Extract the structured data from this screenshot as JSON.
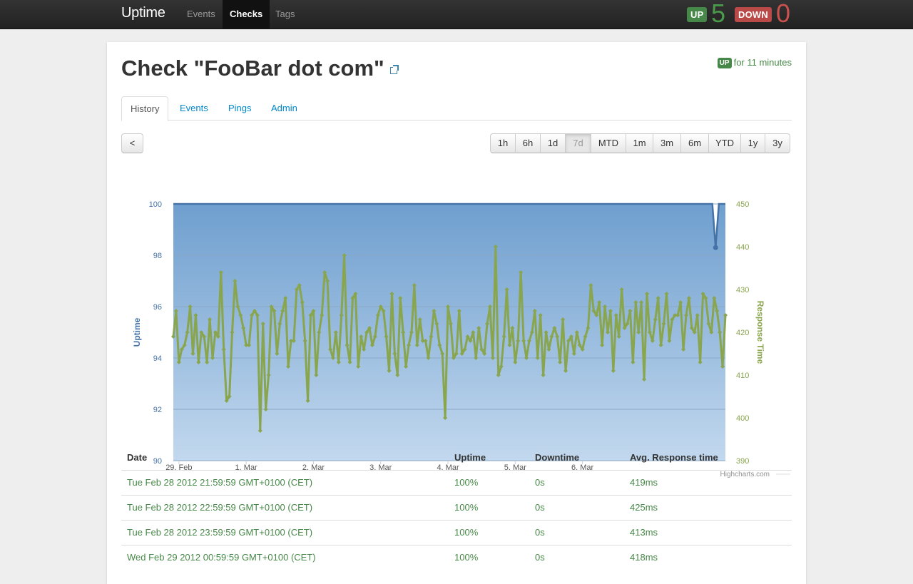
{
  "navbar": {
    "brand": "Uptime",
    "items": [
      {
        "label": "Events",
        "active": false
      },
      {
        "label": "Checks",
        "active": true
      },
      {
        "label": "Tags",
        "active": false
      }
    ],
    "up_label": "UP",
    "up_count": "5",
    "down_label": "DOWN",
    "down_count": "0"
  },
  "check": {
    "title": "Check \"FooBar dot com\"",
    "status_badge": "UP",
    "status_text": "for 11 minutes"
  },
  "tabs": [
    {
      "label": "History",
      "active": true
    },
    {
      "label": "Events",
      "active": false
    },
    {
      "label": "Pings",
      "active": false
    },
    {
      "label": "Admin",
      "active": false
    }
  ],
  "back_button": "<",
  "ranges": [
    {
      "label": "1h",
      "active": false
    },
    {
      "label": "6h",
      "active": false
    },
    {
      "label": "1d",
      "active": false
    },
    {
      "label": "7d",
      "active": true
    },
    {
      "label": "MTD",
      "active": false
    },
    {
      "label": "1m",
      "active": false
    },
    {
      "label": "3m",
      "active": false
    },
    {
      "label": "6m",
      "active": false
    },
    {
      "label": "YTD",
      "active": false
    },
    {
      "label": "1y",
      "active": false
    },
    {
      "label": "3y",
      "active": false
    }
  ],
  "chart_data": {
    "type": "line",
    "credit": "Highcharts.com",
    "x_start": "2012-02-28T22:00",
    "x_ticks": [
      "29. Feb",
      "1. Mar",
      "2. Mar",
      "3. Mar",
      "4. Mar",
      "5. Mar",
      "6. Mar"
    ],
    "y_left": {
      "label": "Uptime",
      "range": [
        90,
        100
      ],
      "ticks": [
        90,
        92,
        94,
        96,
        98,
        100
      ],
      "color": "#4572a7"
    },
    "y_right": {
      "label": "Response Time",
      "range": [
        390,
        450
      ],
      "ticks": [
        390,
        400,
        410,
        420,
        430,
        440,
        450
      ],
      "color": "#89a54e"
    },
    "grid": true,
    "series": [
      {
        "name": "Uptime",
        "axis": "left",
        "type": "area",
        "values": [
          100,
          100,
          100,
          100,
          100,
          100,
          100,
          100,
          100,
          100,
          100,
          100,
          100,
          100,
          100,
          100,
          100,
          100,
          100,
          100,
          100,
          100,
          100,
          100,
          100,
          100,
          100,
          100,
          100,
          100,
          100,
          100,
          100,
          100,
          100,
          100,
          100,
          100,
          100,
          100,
          100,
          100,
          100,
          100,
          100,
          100,
          100,
          100,
          100,
          100,
          100,
          100,
          100,
          100,
          100,
          100,
          100,
          100,
          100,
          100,
          100,
          100,
          100,
          100,
          100,
          100,
          100,
          100,
          100,
          100,
          100,
          100,
          100,
          100,
          100,
          100,
          100,
          100,
          100,
          100,
          100,
          100,
          100,
          100,
          100,
          100,
          100,
          100,
          100,
          100,
          100,
          100,
          100,
          100,
          100,
          100,
          100,
          100,
          100,
          100,
          100,
          100,
          100,
          100,
          100,
          100,
          100,
          100,
          100,
          100,
          100,
          100,
          100,
          100,
          100,
          100,
          100,
          100,
          100,
          100,
          100,
          100,
          100,
          100,
          100,
          100,
          100,
          100,
          100,
          100,
          100,
          100,
          100,
          100,
          100,
          100,
          100,
          100,
          100,
          100,
          100,
          100,
          100,
          100,
          100,
          100,
          100,
          100,
          100,
          100,
          100,
          100,
          100,
          100,
          100,
          100,
          100,
          100,
          100,
          100,
          100,
          100,
          100,
          100,
          100,
          100,
          98.3,
          100,
          100,
          100
        ]
      },
      {
        "name": "Response Time",
        "axis": "right",
        "type": "line",
        "values": [
          419,
          425,
          413,
          416,
          417,
          420,
          426,
          415,
          424,
          413,
          420,
          419,
          413,
          423,
          414,
          420,
          419,
          434,
          416,
          404,
          405,
          420,
          432,
          426,
          424,
          421,
          417,
          417,
          424,
          425,
          424,
          397,
          422,
          402,
          410,
          426,
          425,
          415,
          422,
          425,
          428,
          412,
          418,
          418,
          430,
          431,
          427,
          418,
          404,
          424,
          425,
          410,
          420,
          424,
          434,
          432,
          416,
          414,
          420,
          413,
          424,
          438,
          417,
          413,
          428,
          429,
          412,
          419,
          416,
          420,
          421,
          417,
          419,
          424,
          426,
          425,
          419,
          411,
          429,
          415,
          410,
          428,
          420,
          412,
          417,
          420,
          431,
          417,
          423,
          418,
          418,
          414,
          419,
          425,
          422,
          417,
          415,
          400,
          426,
          422,
          414,
          415,
          425,
          415,
          416,
          419,
          418,
          420,
          414,
          421,
          416,
          415,
          422,
          426,
          414,
          440,
          410,
          412,
          419,
          430,
          417,
          421,
          413,
          418,
          434,
          418,
          414,
          418,
          420,
          425,
          414,
          424,
          410,
          420,
          416,
          419,
          421,
          419,
          413,
          423,
          411,
          418,
          419,
          415,
          420,
          417,
          416,
          419,
          421,
          431,
          425,
          424,
          427,
          417,
          426,
          420,
          425,
          411,
          424,
          419,
          430,
          421,
          422,
          425,
          413,
          427,
          420,
          427,
          409,
          429,
          420,
          418,
          423,
          428,
          417,
          422,
          429,
          418,
          423,
          424,
          424,
          427,
          416,
          424,
          428,
          421,
          420,
          424,
          413,
          429,
          428,
          422,
          420,
          428,
          425,
          420,
          412,
          424
        ]
      }
    ]
  },
  "table": {
    "headers": [
      "Date",
      "Uptime",
      "Downtime",
      "Avg. Response time"
    ],
    "rows": [
      {
        "date": "Tue Feb 28 2012 21:59:59 GMT+0100 (CET)",
        "uptime": "100%",
        "downtime": "0s",
        "avg": "419ms"
      },
      {
        "date": "Tue Feb 28 2012 22:59:59 GMT+0100 (CET)",
        "uptime": "100%",
        "downtime": "0s",
        "avg": "425ms"
      },
      {
        "date": "Tue Feb 28 2012 23:59:59 GMT+0100 (CET)",
        "uptime": "100%",
        "downtime": "0s",
        "avg": "413ms"
      },
      {
        "date": "Wed Feb 29 2012 00:59:59 GMT+0100 (CET)",
        "uptime": "100%",
        "downtime": "0s",
        "avg": "418ms"
      }
    ]
  }
}
